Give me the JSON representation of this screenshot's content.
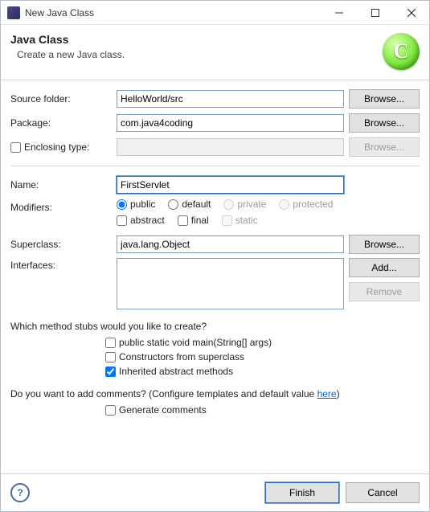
{
  "window": {
    "title": "New Java Class"
  },
  "banner": {
    "heading": "Java Class",
    "sub": "Create a new Java class.",
    "letter": "C"
  },
  "labels": {
    "source_folder": "Source folder:",
    "package": "Package:",
    "enclosing_type": "Enclosing type:",
    "name": "Name:",
    "modifiers": "Modifiers:",
    "superclass": "Superclass:",
    "interfaces": "Interfaces:"
  },
  "values": {
    "source_folder": "HelloWorld/src",
    "package": "com.java4coding",
    "enclosing_type": "",
    "name": "FirstServlet",
    "superclass": "java.lang.Object"
  },
  "buttons": {
    "browse": "Browse...",
    "add": "Add...",
    "remove": "Remove",
    "finish": "Finish",
    "cancel": "Cancel"
  },
  "modifiers": {
    "access": {
      "public": "public",
      "default": "default",
      "private": "private",
      "protected": "protected"
    },
    "other": {
      "abstract": "abstract",
      "final": "final",
      "static": "static"
    }
  },
  "stubs": {
    "question": "Which method stubs would you like to create?",
    "main": "public static void main(String[] args)",
    "constructors": "Constructors from superclass",
    "inherited": "Inherited abstract methods"
  },
  "comments": {
    "question_prefix": "Do you want to add comments? (Configure templates and default value ",
    "link": "here",
    "question_suffix": ")",
    "generate": "Generate comments"
  }
}
